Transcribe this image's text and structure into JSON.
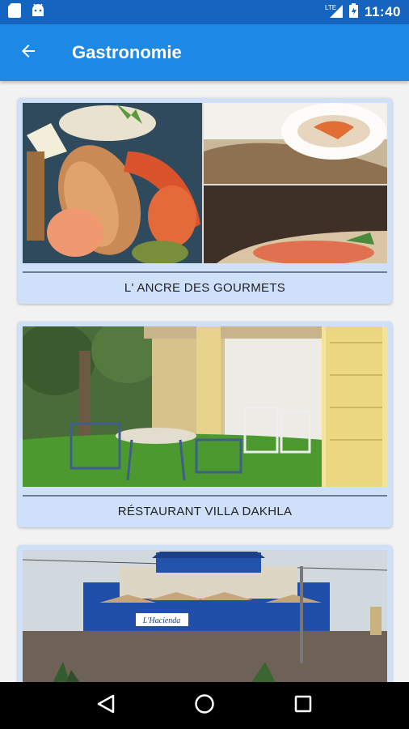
{
  "status_bar": {
    "time": "11:40",
    "network": "LTE",
    "left_icons": [
      "sd-card-icon",
      "android-icon"
    ]
  },
  "app_bar": {
    "title": "Gastronomie",
    "back_icon": "arrow-back-icon"
  },
  "restaurants": [
    {
      "name": "L' ANCRE DES GOURMETS"
    },
    {
      "name": "RÉSTAURANT VILLA DAKHLA"
    },
    {
      "name": ""
    }
  ],
  "third_card_sign": "L'Hacienda",
  "nav_bar": {
    "icons": [
      "back-triangle-icon",
      "home-circle-icon",
      "recents-square-icon"
    ]
  },
  "colors": {
    "status_bar": "#1565c0",
    "app_bar": "#1e88e5",
    "card_background": "#cfe0fb",
    "page_background": "#f2f2f2"
  }
}
